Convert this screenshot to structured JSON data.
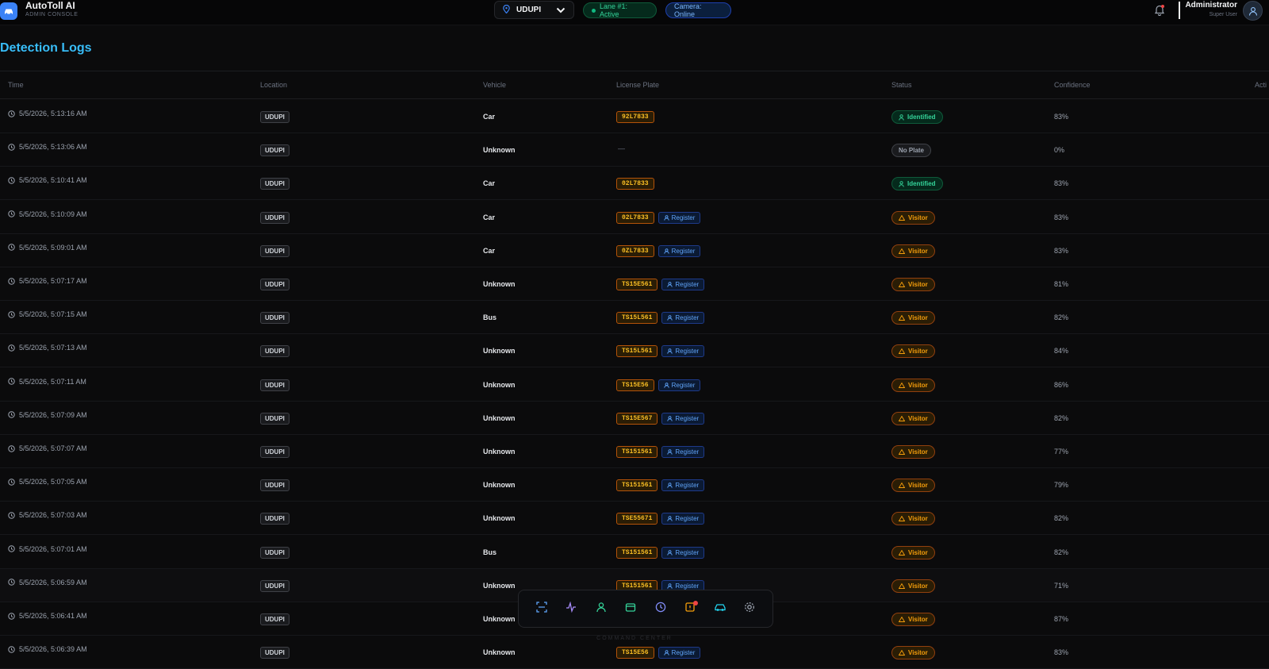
{
  "app": {
    "title": "AutoToll AI",
    "subtitle": "ADMIN CONSOLE"
  },
  "header": {
    "location": "UDUPI",
    "lane_status": "Lane #1: Active",
    "camera_status": "Camera: Online",
    "user_name": "Administrator",
    "user_role": "Super User"
  },
  "page": {
    "title": "Detection Logs"
  },
  "table": {
    "columns": [
      "Time",
      "Location",
      "Vehicle",
      "License Plate",
      "Status",
      "Confidence",
      "Acti"
    ],
    "rows": [
      {
        "time": "5/5/2026, 5:13:16 AM",
        "location": "UDUPI",
        "vehicle": "Car",
        "plate": "92L7833",
        "register": "",
        "status": "Identified",
        "kind": "identified",
        "confidence": "83%"
      },
      {
        "time": "5/5/2026, 5:13:06 AM",
        "location": "UDUPI",
        "vehicle": "Unknown",
        "plate": "",
        "dash": "—",
        "register": "",
        "status": "No Plate",
        "kind": "noplate",
        "confidence": "0%"
      },
      {
        "time": "5/5/2026, 5:10:41 AM",
        "location": "UDUPI",
        "vehicle": "Car",
        "plate": "02L7833",
        "register": "",
        "status": "Identified",
        "kind": "identified",
        "confidence": "83%"
      },
      {
        "time": "5/5/2026, 5:10:09 AM",
        "location": "UDUPI",
        "vehicle": "Car",
        "plate": "02L7833",
        "register": "Register",
        "status": "Visitor",
        "kind": "visitor",
        "confidence": "83%"
      },
      {
        "time": "5/5/2026, 5:09:01 AM",
        "location": "UDUPI",
        "vehicle": "Car",
        "plate": "0ZL7833",
        "register": "Register",
        "status": "Visitor",
        "kind": "visitor",
        "confidence": "83%"
      },
      {
        "time": "5/5/2026, 5:07:17 AM",
        "location": "UDUPI",
        "vehicle": "Unknown",
        "plate": "TS15E561",
        "register": "Register",
        "status": "Visitor",
        "kind": "visitor",
        "confidence": "81%"
      },
      {
        "time": "5/5/2026, 5:07:15 AM",
        "location": "UDUPI",
        "vehicle": "Bus",
        "plate": "TS15L561",
        "register": "Register",
        "status": "Visitor",
        "kind": "visitor",
        "confidence": "82%"
      },
      {
        "time": "5/5/2026, 5:07:13 AM",
        "location": "UDUPI",
        "vehicle": "Unknown",
        "plate": "TS15L561",
        "register": "Register",
        "status": "Visitor",
        "kind": "visitor",
        "confidence": "84%"
      },
      {
        "time": "5/5/2026, 5:07:11 AM",
        "location": "UDUPI",
        "vehicle": "Unknown",
        "plate": "TS15E56",
        "register": "Register",
        "status": "Visitor",
        "kind": "visitor",
        "confidence": "86%"
      },
      {
        "time": "5/5/2026, 5:07:09 AM",
        "location": "UDUPI",
        "vehicle": "Unknown",
        "plate": "TS15E567",
        "register": "Register",
        "status": "Visitor",
        "kind": "visitor",
        "confidence": "82%"
      },
      {
        "time": "5/5/2026, 5:07:07 AM",
        "location": "UDUPI",
        "vehicle": "Unknown",
        "plate": "TS151561",
        "register": "Register",
        "status": "Visitor",
        "kind": "visitor",
        "confidence": "77%"
      },
      {
        "time": "5/5/2026, 5:07:05 AM",
        "location": "UDUPI",
        "vehicle": "Unknown",
        "plate": "TS151561",
        "register": "Register",
        "status": "Visitor",
        "kind": "visitor",
        "confidence": "79%"
      },
      {
        "time": "5/5/2026, 5:07:03 AM",
        "location": "UDUPI",
        "vehicle": "Unknown",
        "plate": "TSE55671",
        "register": "Register",
        "status": "Visitor",
        "kind": "visitor",
        "confidence": "82%"
      },
      {
        "time": "5/5/2026, 5:07:01 AM",
        "location": "UDUPI",
        "vehicle": "Bus",
        "plate": "TS151561",
        "register": "Register",
        "status": "Visitor",
        "kind": "visitor",
        "confidence": "82%"
      },
      {
        "time": "5/5/2026, 5:06:59 AM",
        "location": "UDUPI",
        "vehicle": "Unknown",
        "plate": "TS151561",
        "register": "Register",
        "status": "Visitor",
        "kind": "visitor",
        "confidence": "71%"
      },
      {
        "time": "5/5/2026, 5:06:41 AM",
        "location": "UDUPI",
        "vehicle": "Unknown",
        "plate": "",
        "register": "",
        "status": "Visitor",
        "kind": "visitor",
        "confidence": "87%"
      },
      {
        "time": "5/5/2026, 5:06:39 AM",
        "location": "UDUPI",
        "vehicle": "Unknown",
        "plate": "TS15E56",
        "register": "Register",
        "status": "Visitor",
        "kind": "visitor",
        "confidence": "83%"
      }
    ]
  },
  "dock": {
    "label": "COMMAND CENTER",
    "items": [
      {
        "icon": "scan-icon",
        "color": "#60a5fa"
      },
      {
        "icon": "activity-icon",
        "color": "#a78bfa"
      },
      {
        "icon": "user-icon",
        "color": "#34d399"
      },
      {
        "icon": "wallet-icon",
        "color": "#34d399"
      },
      {
        "icon": "clock-icon",
        "color": "#818cf8"
      },
      {
        "icon": "alert-note-icon",
        "color": "#f59e0b"
      },
      {
        "icon": "car-icon",
        "color": "#22d3ee"
      },
      {
        "icon": "gear-icon",
        "color": "#9ca3af"
      }
    ]
  },
  "colors": {
    "accent_title": "#38bdf8",
    "plate": "#fbbf24",
    "register": "#60a5fa",
    "identified": "#34d399",
    "visitor": "#f59e0b"
  }
}
